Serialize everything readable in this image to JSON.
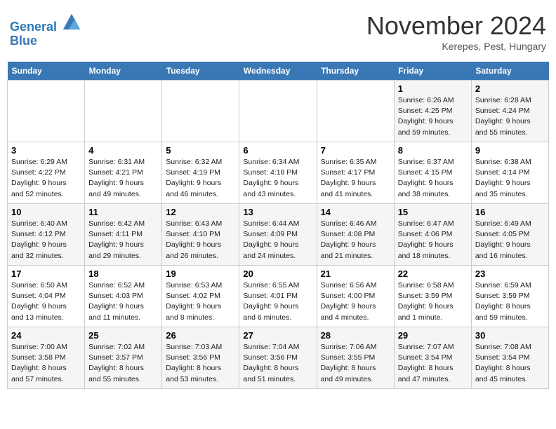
{
  "header": {
    "logo_line1": "General",
    "logo_line2": "Blue",
    "month": "November 2024",
    "location": "Kerepes, Pest, Hungary"
  },
  "weekdays": [
    "Sunday",
    "Monday",
    "Tuesday",
    "Wednesday",
    "Thursday",
    "Friday",
    "Saturday"
  ],
  "weeks": [
    [
      {
        "day": "",
        "info": ""
      },
      {
        "day": "",
        "info": ""
      },
      {
        "day": "",
        "info": ""
      },
      {
        "day": "",
        "info": ""
      },
      {
        "day": "",
        "info": ""
      },
      {
        "day": "1",
        "info": "Sunrise: 6:26 AM\nSunset: 4:25 PM\nDaylight: 9 hours\nand 59 minutes."
      },
      {
        "day": "2",
        "info": "Sunrise: 6:28 AM\nSunset: 4:24 PM\nDaylight: 9 hours\nand 55 minutes."
      }
    ],
    [
      {
        "day": "3",
        "info": "Sunrise: 6:29 AM\nSunset: 4:22 PM\nDaylight: 9 hours\nand 52 minutes."
      },
      {
        "day": "4",
        "info": "Sunrise: 6:31 AM\nSunset: 4:21 PM\nDaylight: 9 hours\nand 49 minutes."
      },
      {
        "day": "5",
        "info": "Sunrise: 6:32 AM\nSunset: 4:19 PM\nDaylight: 9 hours\nand 46 minutes."
      },
      {
        "day": "6",
        "info": "Sunrise: 6:34 AM\nSunset: 4:18 PM\nDaylight: 9 hours\nand 43 minutes."
      },
      {
        "day": "7",
        "info": "Sunrise: 6:35 AM\nSunset: 4:17 PM\nDaylight: 9 hours\nand 41 minutes."
      },
      {
        "day": "8",
        "info": "Sunrise: 6:37 AM\nSunset: 4:15 PM\nDaylight: 9 hours\nand 38 minutes."
      },
      {
        "day": "9",
        "info": "Sunrise: 6:38 AM\nSunset: 4:14 PM\nDaylight: 9 hours\nand 35 minutes."
      }
    ],
    [
      {
        "day": "10",
        "info": "Sunrise: 6:40 AM\nSunset: 4:12 PM\nDaylight: 9 hours\nand 32 minutes."
      },
      {
        "day": "11",
        "info": "Sunrise: 6:42 AM\nSunset: 4:11 PM\nDaylight: 9 hours\nand 29 minutes."
      },
      {
        "day": "12",
        "info": "Sunrise: 6:43 AM\nSunset: 4:10 PM\nDaylight: 9 hours\nand 26 minutes."
      },
      {
        "day": "13",
        "info": "Sunrise: 6:44 AM\nSunset: 4:09 PM\nDaylight: 9 hours\nand 24 minutes."
      },
      {
        "day": "14",
        "info": "Sunrise: 6:46 AM\nSunset: 4:08 PM\nDaylight: 9 hours\nand 21 minutes."
      },
      {
        "day": "15",
        "info": "Sunrise: 6:47 AM\nSunset: 4:06 PM\nDaylight: 9 hours\nand 18 minutes."
      },
      {
        "day": "16",
        "info": "Sunrise: 6:49 AM\nSunset: 4:05 PM\nDaylight: 9 hours\nand 16 minutes."
      }
    ],
    [
      {
        "day": "17",
        "info": "Sunrise: 6:50 AM\nSunset: 4:04 PM\nDaylight: 9 hours\nand 13 minutes."
      },
      {
        "day": "18",
        "info": "Sunrise: 6:52 AM\nSunset: 4:03 PM\nDaylight: 9 hours\nand 11 minutes."
      },
      {
        "day": "19",
        "info": "Sunrise: 6:53 AM\nSunset: 4:02 PM\nDaylight: 9 hours\nand 8 minutes."
      },
      {
        "day": "20",
        "info": "Sunrise: 6:55 AM\nSunset: 4:01 PM\nDaylight: 9 hours\nand 6 minutes."
      },
      {
        "day": "21",
        "info": "Sunrise: 6:56 AM\nSunset: 4:00 PM\nDaylight: 9 hours\nand 4 minutes."
      },
      {
        "day": "22",
        "info": "Sunrise: 6:58 AM\nSunset: 3:59 PM\nDaylight: 9 hours\nand 1 minute."
      },
      {
        "day": "23",
        "info": "Sunrise: 6:59 AM\nSunset: 3:59 PM\nDaylight: 8 hours\nand 59 minutes."
      }
    ],
    [
      {
        "day": "24",
        "info": "Sunrise: 7:00 AM\nSunset: 3:58 PM\nDaylight: 8 hours\nand 57 minutes."
      },
      {
        "day": "25",
        "info": "Sunrise: 7:02 AM\nSunset: 3:57 PM\nDaylight: 8 hours\nand 55 minutes."
      },
      {
        "day": "26",
        "info": "Sunrise: 7:03 AM\nSunset: 3:56 PM\nDaylight: 8 hours\nand 53 minutes."
      },
      {
        "day": "27",
        "info": "Sunrise: 7:04 AM\nSunset: 3:56 PM\nDaylight: 8 hours\nand 51 minutes."
      },
      {
        "day": "28",
        "info": "Sunrise: 7:06 AM\nSunset: 3:55 PM\nDaylight: 8 hours\nand 49 minutes."
      },
      {
        "day": "29",
        "info": "Sunrise: 7:07 AM\nSunset: 3:54 PM\nDaylight: 8 hours\nand 47 minutes."
      },
      {
        "day": "30",
        "info": "Sunrise: 7:08 AM\nSunset: 3:54 PM\nDaylight: 8 hours\nand 45 minutes."
      }
    ]
  ]
}
